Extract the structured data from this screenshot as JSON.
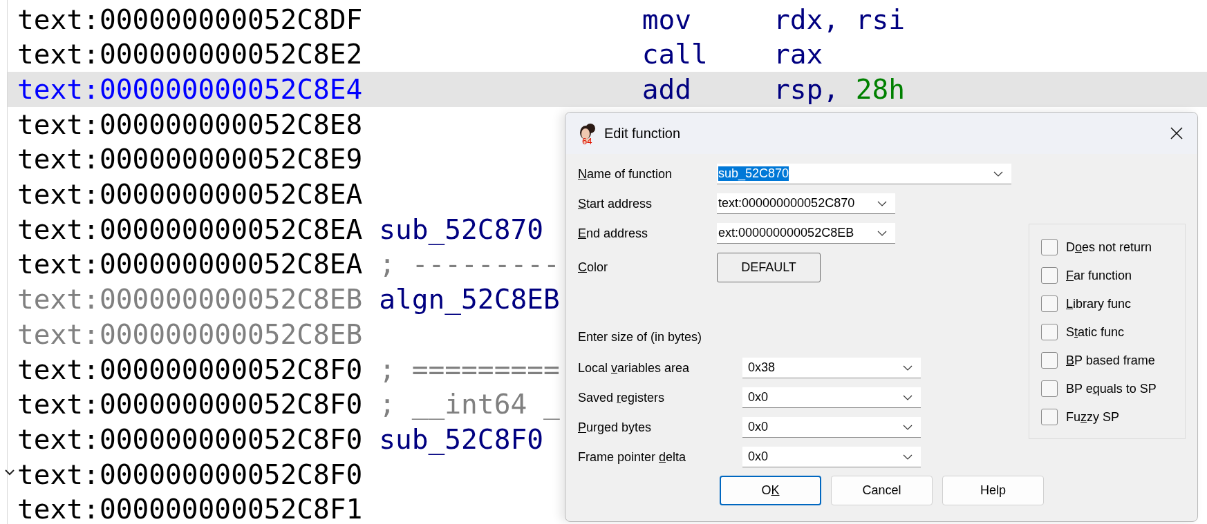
{
  "listing": {
    "rows": [
      {
        "address": "text:000000000052C8DF",
        "selected": false,
        "greyed": false,
        "fold": false,
        "mnemonic": "mov",
        "operands": [
          {
            "text": "rdx, rsi",
            "kind": "reg"
          }
        ]
      },
      {
        "address": "text:000000000052C8E2",
        "selected": false,
        "greyed": false,
        "fold": false,
        "mnemonic": "call",
        "operands": [
          {
            "text": "rax",
            "kind": "reg"
          }
        ]
      },
      {
        "address": "text:000000000052C8E4",
        "selected": true,
        "greyed": false,
        "fold": false,
        "mnemonic": "add",
        "operands": [
          {
            "text": "rsp, ",
            "kind": "reg"
          },
          {
            "text": "28h",
            "kind": "number"
          }
        ]
      },
      {
        "address": "text:000000000052C8E8",
        "selected": false,
        "greyed": false,
        "fold": false
      },
      {
        "address": "text:000000000052C8E9",
        "selected": false,
        "greyed": false,
        "fold": false
      },
      {
        "address": "text:000000000052C8EA",
        "selected": false,
        "greyed": false,
        "fold": false
      },
      {
        "address": "text:000000000052C8EA",
        "selected": false,
        "greyed": false,
        "fold": false,
        "name": {
          "text": "sub_52C870",
          "kind": "label"
        }
      },
      {
        "address": "text:000000000052C8EA",
        "selected": false,
        "greyed": false,
        "fold": false,
        "name": {
          "text": "; ---------",
          "kind": "comment"
        }
      },
      {
        "address": "text:000000000052C8EB",
        "selected": false,
        "greyed": true,
        "fold": false,
        "name": {
          "text": "algn_52C8EB",
          "kind": "label"
        }
      },
      {
        "address": "text:000000000052C8EB",
        "selected": false,
        "greyed": true,
        "fold": false
      },
      {
        "address": "text:000000000052C8F0",
        "selected": false,
        "greyed": false,
        "fold": false,
        "name": {
          "text": "; =========",
          "kind": "comment"
        }
      },
      {
        "address": "text:000000000052C8F0",
        "selected": false,
        "greyed": false,
        "fold": false,
        "name": {
          "text": "; __int64 _",
          "kind": "comment"
        }
      },
      {
        "address": "text:000000000052C8F0",
        "selected": false,
        "greyed": false,
        "fold": false,
        "name": {
          "text": "sub_52C8F0",
          "kind": "label"
        }
      },
      {
        "address": "text:000000000052C8F0",
        "selected": false,
        "greyed": false,
        "fold": true
      },
      {
        "address": "text:000000000052C8F1",
        "selected": false,
        "greyed": false,
        "fold": false
      }
    ]
  },
  "dialog": {
    "title": "Edit function",
    "icon_badge": "64",
    "fields": [
      {
        "label": {
          "key": "N",
          "post": "ame of function"
        },
        "value": "sub_52C870",
        "text_selected": true,
        "kind": "wide"
      },
      {
        "label": {
          "key": "S",
          "post": "tart address"
        },
        "value": "text:000000000052C870",
        "text_selected": false,
        "kind": "narrow"
      },
      {
        "label": {
          "key": "E",
          "post": "nd address"
        },
        "value": "ext:000000000052C8EB",
        "text_selected": false,
        "kind": "narrow"
      }
    ],
    "color": {
      "label": {
        "key": "C",
        "post": "olor"
      },
      "button": "DEFAULT"
    },
    "size_heading": "Enter size of (in bytes)",
    "size_fields": [
      {
        "label": {
          "pre": "Local ",
          "key": "v",
          "post": "ariables area"
        },
        "value": "0x38"
      },
      {
        "label": {
          "pre": "Saved ",
          "key": "r",
          "post": "egisters"
        },
        "value": "0x0"
      },
      {
        "label": {
          "key": "P",
          "post": "urged bytes"
        },
        "value": "0x0"
      },
      {
        "label": {
          "pre": "Frame pointer ",
          "key": "d",
          "post": "elta"
        },
        "value": "0x0"
      }
    ],
    "options": [
      {
        "label": {
          "pre": "D",
          "key": "o",
          "post": "es not return"
        },
        "checked": false
      },
      {
        "label": {
          "key": "F",
          "post": "ar function"
        },
        "checked": false
      },
      {
        "label": {
          "key": "L",
          "post": "ibrary func"
        },
        "checked": false
      },
      {
        "label": {
          "pre": "S",
          "key": "t",
          "post": "atic func"
        },
        "checked": false
      },
      {
        "label": {
          "key": "B",
          "post": "P based frame"
        },
        "checked": false
      },
      {
        "label": {
          "pre": "BP e",
          "key": "q",
          "post": "uals to SP"
        },
        "checked": false
      },
      {
        "label": {
          "pre": "Fu",
          "key": "z",
          "post": "zy SP"
        },
        "checked": false
      }
    ],
    "buttons": [
      {
        "label": {
          "pre": "O",
          "key": "K"
        },
        "default": true
      },
      {
        "label": {
          "pre": "Cancel"
        },
        "default": false
      },
      {
        "label": {
          "pre": "Help"
        },
        "default": false
      }
    ]
  }
}
